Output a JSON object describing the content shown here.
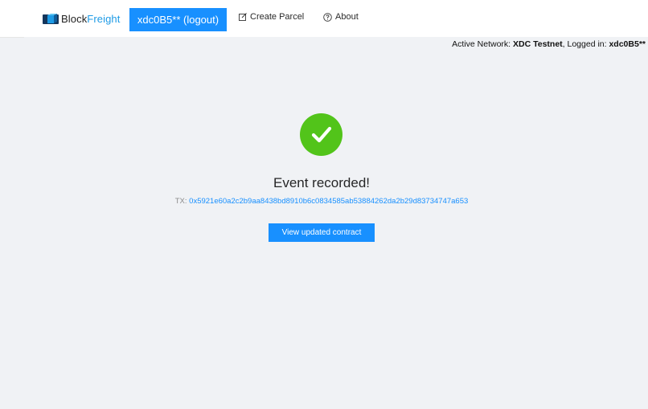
{
  "header": {
    "logo_part1": "Block",
    "logo_part2": "Freight",
    "user_menu_label": "xdc0B5** (logout)",
    "create_parcel_label": "Create Parcel",
    "about_label": "About"
  },
  "status": {
    "network_prefix": "Active Network: ",
    "network_name": "XDC Testnet",
    "logged_prefix": ", Logged in: ",
    "logged_user": "xdc0B5**"
  },
  "result": {
    "title": "Event recorded!",
    "tx_label": "TX: ",
    "tx_hash": "0x5921e60a2c2b9aa8438bd8910b6c0834585ab53884262da2b29d83734747a653",
    "button_label": "View updated contract"
  },
  "colors": {
    "primary": "#1890ff",
    "success": "#52c41a",
    "background": "#f0f2f5"
  }
}
